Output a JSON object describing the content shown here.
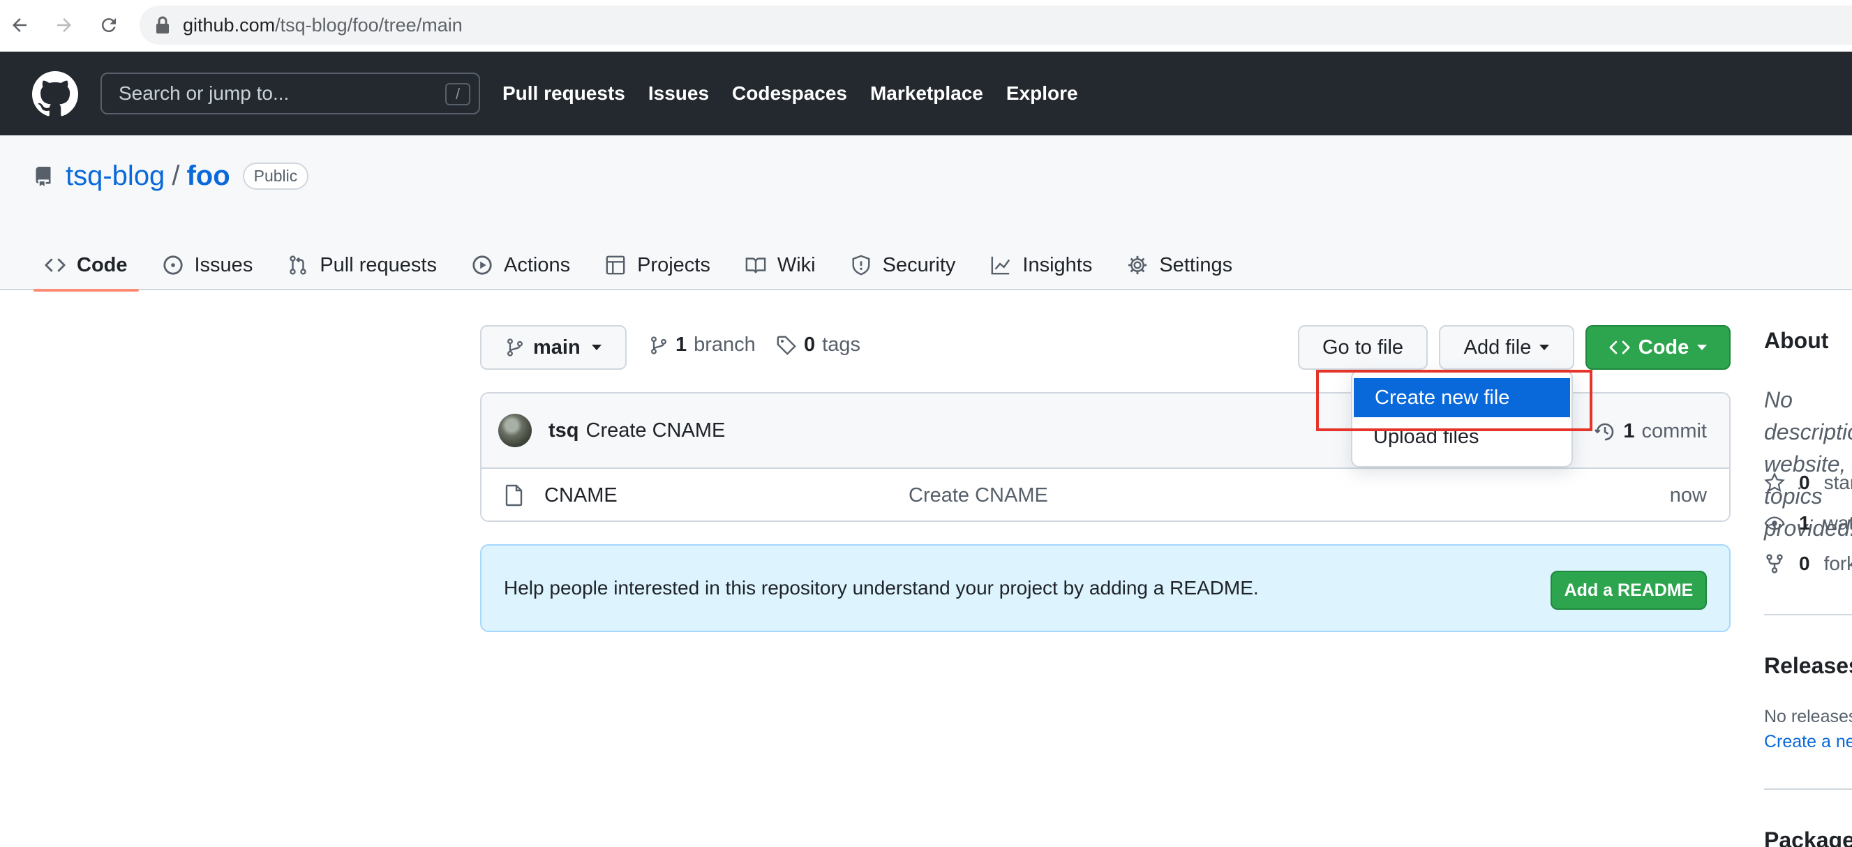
{
  "browser": {
    "url_host": "github.com",
    "url_path": "/tsq-blog/foo/tree/main"
  },
  "header": {
    "search_placeholder": "Search or jump to...",
    "search_shortcut": "/",
    "nav": [
      "Pull requests",
      "Issues",
      "Codespaces",
      "Marketplace",
      "Explore"
    ]
  },
  "repo": {
    "owner": "tsq-blog",
    "separator": "/",
    "name": "foo",
    "visibility": "Public"
  },
  "tabs": [
    {
      "label": "Code",
      "icon": "code-icon",
      "active": true
    },
    {
      "label": "Issues",
      "icon": "issue-icon"
    },
    {
      "label": "Pull requests",
      "icon": "pull-request-icon"
    },
    {
      "label": "Actions",
      "icon": "play-icon"
    },
    {
      "label": "Projects",
      "icon": "table-icon"
    },
    {
      "label": "Wiki",
      "icon": "book-icon"
    },
    {
      "label": "Security",
      "icon": "shield-icon"
    },
    {
      "label": "Insights",
      "icon": "graph-icon"
    },
    {
      "label": "Settings",
      "icon": "gear-icon"
    }
  ],
  "toolbar": {
    "branch": "main",
    "branch_count": "1",
    "branch_label": "branch",
    "tag_count": "0",
    "tag_label": "tags",
    "go_to_file": "Go to file",
    "add_file": "Add file",
    "code": "Code"
  },
  "add_file_menu": {
    "items": [
      "Create new file",
      "Upload files"
    ],
    "selected": "Create new file"
  },
  "latest_commit": {
    "author": "tsq",
    "message": "Create CNAME",
    "commit_count": "1",
    "commit_label": "commit"
  },
  "files": [
    {
      "name": "CNAME",
      "message": "Create CNAME",
      "age": "now"
    }
  ],
  "readme_banner": {
    "text": "Help people interested in this repository understand your project by adding a README.",
    "button": "Add a README"
  },
  "sidebar": {
    "about_title": "About",
    "description": "No description, website, or topics provided.",
    "stars": {
      "count": "0",
      "label": "stars"
    },
    "watching": {
      "count": "1",
      "label": "watching"
    },
    "forks": {
      "count": "0",
      "label": "forks"
    },
    "releases_title": "Releases",
    "releases_text": "No releases published",
    "releases_link": "Create a new release",
    "packages_title": "Packages"
  },
  "colors": {
    "header_bg": "#24292f",
    "link": "#0969da",
    "primary_button": "#2da44e",
    "menu_selected": "#0969da",
    "highlight_box": "#e5352b",
    "tab_underline": "#fd8c73"
  }
}
